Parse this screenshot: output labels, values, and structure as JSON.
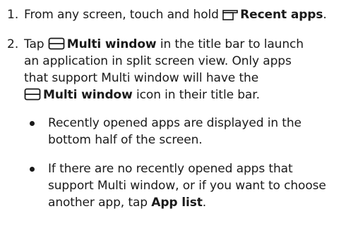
{
  "step1": {
    "number": "1.",
    "text_before": "From any screen, touch and hold",
    "icon": "recent-apps-icon",
    "bold_label": "Recent apps",
    "text_after": "."
  },
  "step2": {
    "number": "2.",
    "line1_before": "Tap",
    "line1_icon": "multi-window-icon",
    "line1_bold": "Multi window",
    "line1_after": "in the title bar to launch",
    "line2": "an application in split screen view. Only apps",
    "line3": "that support Multi window will have the",
    "line4_icon": "multi-window-icon",
    "line4_bold": "Multi window",
    "line4_after": "icon in their title bar."
  },
  "bullets": [
    {
      "line1": "Recently opened apps are displayed in the",
      "line2": "bottom half of the screen."
    },
    {
      "line1": "If there are no recently opened apps that",
      "line2": "support Multi window, or if you want to choose",
      "line3_before": "another app, tap",
      "line3_bold": "App list",
      "line3_after": "."
    }
  ],
  "colors": {
    "text": "#1a1a1a"
  }
}
